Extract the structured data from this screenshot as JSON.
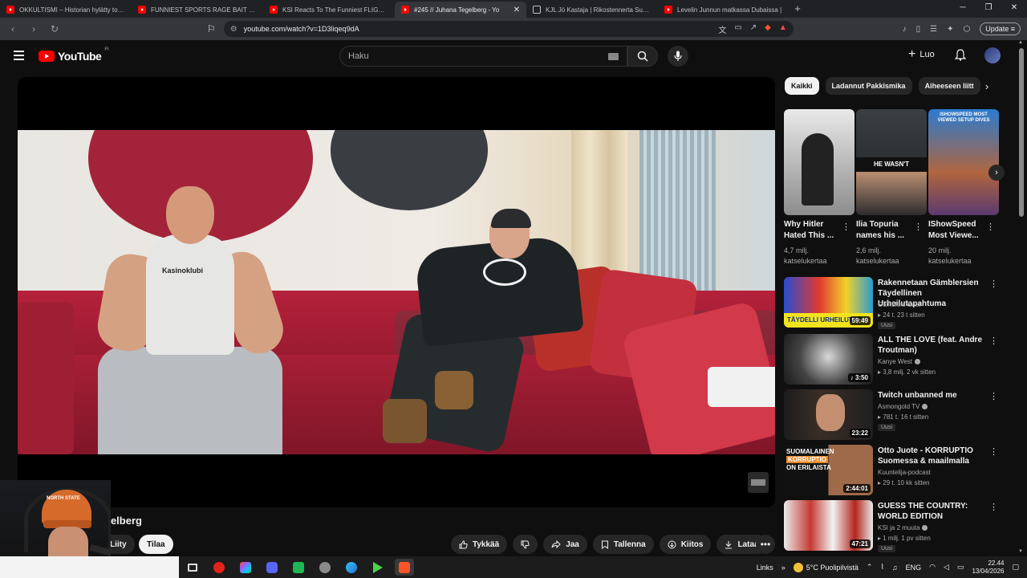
{
  "browser": {
    "tabs": [
      {
        "title": "OKKULTISMI – Historian hylätty totuu",
        "icon": "youtube-icon",
        "active": false
      },
      {
        "title": "FUNNIEST SPORTS RAGE BAIT MOME",
        "icon": "youtube-icon",
        "active": false
      },
      {
        "title": "KSI Reacts To The Funniest FLIGHT R",
        "icon": "youtube-icon",
        "active": false
      },
      {
        "title": "#245 // Juhana Tegelberg - Yo",
        "icon": "youtube-icon",
        "active": true
      },
      {
        "title": "KJL Jö Kastaja | Rikostennerta Suome",
        "icon": "instagram-icon",
        "active": false
      },
      {
        "title": "Levelin Junnun matkassa Dubaissa |",
        "icon": "youtube-icon",
        "active": false
      }
    ],
    "url": "youtube.com/watch?v=1D3liqeq9dA",
    "update_label": "Update"
  },
  "masthead": {
    "logo_text": "YouTube",
    "country_code": "FI",
    "search_placeholder": "Haku",
    "create_label": "Luo"
  },
  "video": {
    "title_partial": "gelberg",
    "join_label": "Liity",
    "subscribe_label": "Tilaa",
    "actions": {
      "like": "Tykkää",
      "share": "Jaa",
      "save": "Tallenna",
      "thanks": "Kiitos",
      "download": "Lataa"
    },
    "shirt_text": "Kasinoklubi",
    "webcam_cap_text": "NORTH STATE"
  },
  "sidebar": {
    "chips": [
      "Kaikki",
      "Ladannut Pakkismika",
      "Aiheeseen liitt"
    ],
    "shorts": [
      {
        "title": "Why Hitler Hated This ...",
        "views": "4,7 milj. katselukertaa"
      },
      {
        "title": "Ilia Topuria names his ...",
        "views": "2,6 milj. katselukertaa",
        "overlay": "HE WASN'T"
      },
      {
        "title": "IShowSpeed Most Viewe...",
        "views": "20 milj. katselukertaa",
        "overlay": "ISHOWSPEED MOST VIEWED SETUP DIVES"
      }
    ],
    "videos": [
      {
        "title": "Rakennetaan Gämblersien Täydellinen Urheilutapahtuma",
        "channel": "Gämblers Cast",
        "meta": "24 t. 23 t sitten",
        "badge": "Uusi",
        "duration": "59:49",
        "thumb_text": "TÄYDELLI URHEILUTAP",
        "verified": false
      },
      {
        "title": "ALL THE LOVE (feat. Andre Troutman)",
        "channel": "Kanye West",
        "meta": "3,8 milj. 2 vk sitten",
        "badge": "",
        "duration": "3:50",
        "verified": true
      },
      {
        "title": "Twitch unbanned me",
        "channel": "Asmongold TV",
        "meta": "781 t. 16 t sitten",
        "badge": "Uusi",
        "duration": "23:22",
        "verified": true
      },
      {
        "title": "Otto Juote - KORRUPTIO Suomessa & maailmalla",
        "channel": "Kuuntelija-podcast",
        "meta": "29 t. 10 kk sitten",
        "badge": "",
        "duration": "2:44:01",
        "thumb_lines": [
          "SUOMALAINEN",
          "KORRUPTIO",
          "ON ERILAISTA"
        ],
        "verified": false
      },
      {
        "title": "GUESS THE COUNTRY: WORLD EDITION",
        "channel": "KSI ja 2 muuta",
        "meta": "1 milj. 1 pv sitten",
        "badge": "Uusi",
        "duration": "47:21",
        "verified": true
      }
    ]
  },
  "taskbar": {
    "links_label": "Links",
    "weather": "5°C Puolipilvistä",
    "language": "ENG",
    "time": "22.44",
    "date": "13/04/2026"
  }
}
